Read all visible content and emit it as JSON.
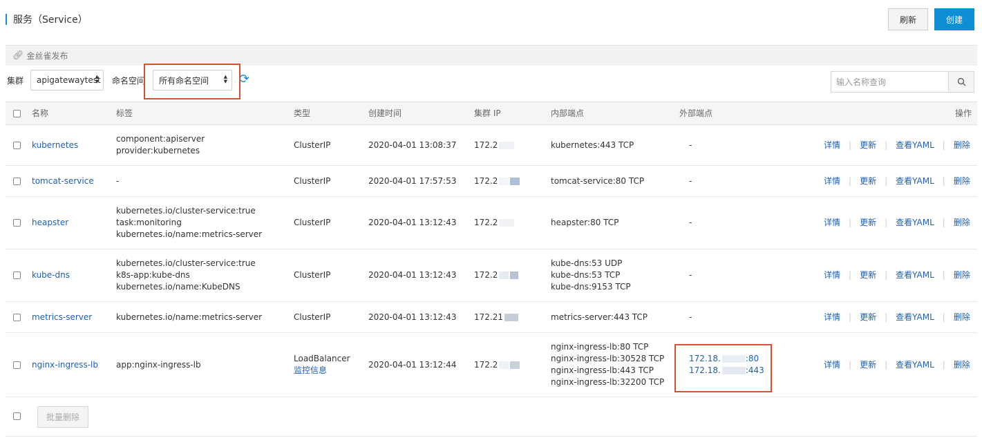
{
  "header": {
    "title": "服务（Service）",
    "refresh_label": "刷新",
    "create_label": "创建"
  },
  "canary": {
    "label": "金丝雀发布"
  },
  "filters": {
    "cluster_label": "集群",
    "cluster_value": "apigatewaytest",
    "namespace_label": "命名空间",
    "namespace_value": "所有命名空间",
    "search_placeholder": "输入名称查询"
  },
  "table": {
    "columns": [
      "名称",
      "标签",
      "类型",
      "创建时间",
      "集群 IP",
      "内部端点",
      "外部端点",
      "操作"
    ],
    "ops": [
      "详情",
      "更新",
      "查看YAML",
      "删除"
    ],
    "rows": [
      {
        "name": "kubernetes",
        "labels": [
          "component:apiserver",
          "provider:kubernetes"
        ],
        "type": [
          "ClusterIP"
        ],
        "created": "2020-04-01 13:08:37",
        "ip": "172.2",
        "internal": [
          "kubernetes:443 TCP"
        ],
        "external": [
          "-"
        ]
      },
      {
        "name": "tomcat-service",
        "labels": [
          "-"
        ],
        "type": [
          "ClusterIP"
        ],
        "created": "2020-04-01 17:57:53",
        "ip": "172.2",
        "internal": [
          "tomcat-service:80 TCP"
        ],
        "external": [
          "-"
        ]
      },
      {
        "name": "heapster",
        "labels": [
          "kubernetes.io/cluster-service:true",
          "task:monitoring",
          "kubernetes.io/name:metrics-server"
        ],
        "type": [
          "ClusterIP"
        ],
        "created": "2020-04-01 13:12:43",
        "ip": "172.2",
        "internal": [
          "heapster:80 TCP"
        ],
        "external": [
          "-"
        ]
      },
      {
        "name": "kube-dns",
        "labels": [
          "kubernetes.io/cluster-service:true",
          "k8s-app:kube-dns",
          "kubernetes.io/name:KubeDNS"
        ],
        "type": [
          "ClusterIP"
        ],
        "created": "2020-04-01 13:12:43",
        "ip": "172.2",
        "internal": [
          "kube-dns:53 UDP",
          "kube-dns:53 TCP",
          "kube-dns:9153 TCP"
        ],
        "external": [
          "-"
        ]
      },
      {
        "name": "metrics-server",
        "labels": [
          "kubernetes.io/name:metrics-server"
        ],
        "type": [
          "ClusterIP"
        ],
        "created": "2020-04-01 13:12:43",
        "ip": "172.21",
        "internal": [
          "metrics-server:443 TCP"
        ],
        "external": [
          "-"
        ]
      },
      {
        "name": "nginx-ingress-lb",
        "labels": [
          "app:nginx-ingress-lb"
        ],
        "type": [
          "LoadBalancer",
          "监控信息"
        ],
        "created": "2020-04-01 13:12:44",
        "ip": "172.2",
        "internal": [
          "nginx-ingress-lb:80 TCP",
          "nginx-ingress-lb:30528 TCP",
          "nginx-ingress-lb:443 TCP",
          "nginx-ingress-lb:32200 TCP"
        ],
        "external": [
          "172.18.",
          ":80",
          "172.18.",
          ":443"
        ]
      }
    ]
  },
  "footer": {
    "batch_delete_label": "批量删除"
  },
  "colors": {
    "accent": "#0e8fd5",
    "link": "#1d60b3",
    "highlight": "#d9502c"
  }
}
